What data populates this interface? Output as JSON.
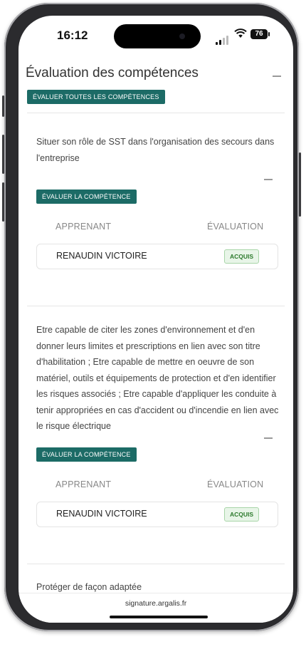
{
  "status_bar": {
    "time": "16:12",
    "battery": "76"
  },
  "section": {
    "title": "Évaluation des compétences",
    "evaluate_all_label": "ÉVALUER TOUTES LES COMPÉTENCES"
  },
  "competences": [
    {
      "text": "Situer son rôle de SST dans l'organisation des secours dans l'entreprise",
      "evaluate_label": "ÉVALUER LA COMPÉTENCE",
      "col_learner": "APPRENANT",
      "col_eval": "ÉVALUATION",
      "learner": {
        "name": "RENAUDIN VICTOIRE",
        "status": "ACQUIS"
      }
    },
    {
      "text": "Etre capable de citer les zones d'environnement et d'en donner leurs limites et prescriptions en lien avec son titre d'habilitation ; Etre capable de mettre en oeuvre de son matériel, outils et équipements de protection et d'en identifier les risques associés ; Etre capable d'appliquer les conduite à tenir appropriées en cas d'accident ou d'incendie en lien avec le risque électrique",
      "evaluate_label": "ÉVALUER LA COMPÉTENCE",
      "col_learner": "APPRENANT",
      "col_eval": "ÉVALUATION",
      "learner": {
        "name": "RENAUDIN VICTOIRE",
        "status": "ACQUIS"
      }
    },
    {
      "text": "Protéger de façon adaptée"
    }
  ],
  "footer": {
    "url": "signature.argalis.fr"
  }
}
